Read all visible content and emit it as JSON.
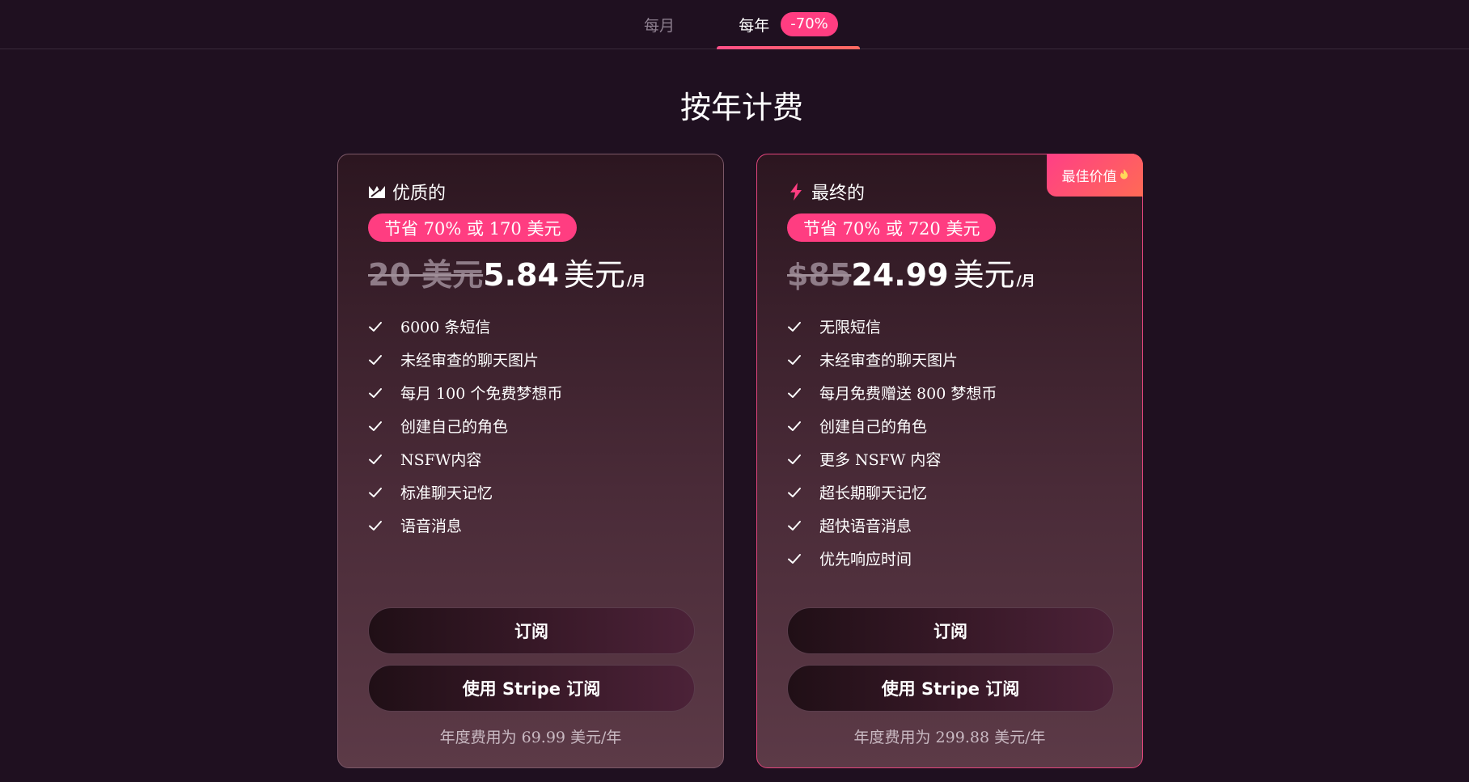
{
  "tabs": {
    "monthly": "每月",
    "yearly": "每年",
    "yearly_discount": "-70%"
  },
  "page_title": "按年计费",
  "plans": {
    "premium": {
      "name": "优质的",
      "icon": "crown-icon",
      "save": "节省 70% 或 170 美元",
      "old_price": "20 美元",
      "new_price": "5.84",
      "price_unit": "美元",
      "per_month": "/月",
      "features": [
        "6000 条短信",
        "未经审查的聊天图片",
        "每月 100 个免费梦想币",
        "创建自己的角色",
        "NSFW内容",
        "标准聊天记忆",
        "语音消息"
      ],
      "subscribe_label": "订阅",
      "stripe_label": "使用 Stripe 订阅",
      "annual_note": "年度费用为 69.99 美元/年"
    },
    "ultimate": {
      "name": "最终的",
      "icon": "lightning-icon",
      "badge": "最佳价值",
      "save": "节省 70% 或 720 美元",
      "old_price": "$85",
      "new_price": "24.99",
      "price_unit": "美元",
      "per_month": "/月",
      "features": [
        "无限短信",
        "未经审查的聊天图片",
        "每月免费赠送 800 梦想币",
        "创建自己的角色",
        "更多 NSFW 内容",
        "超长期聊天记忆",
        "超快语音消息",
        "优先响应时间"
      ],
      "subscribe_label": "订阅",
      "stripe_label": "使用 Stripe 订阅",
      "annual_note": "年度费用为 299.88 美元/年"
    }
  },
  "colors": {
    "background": "#1f1020",
    "accent": "#ff3d81",
    "accent_end": "#ff6a55"
  }
}
